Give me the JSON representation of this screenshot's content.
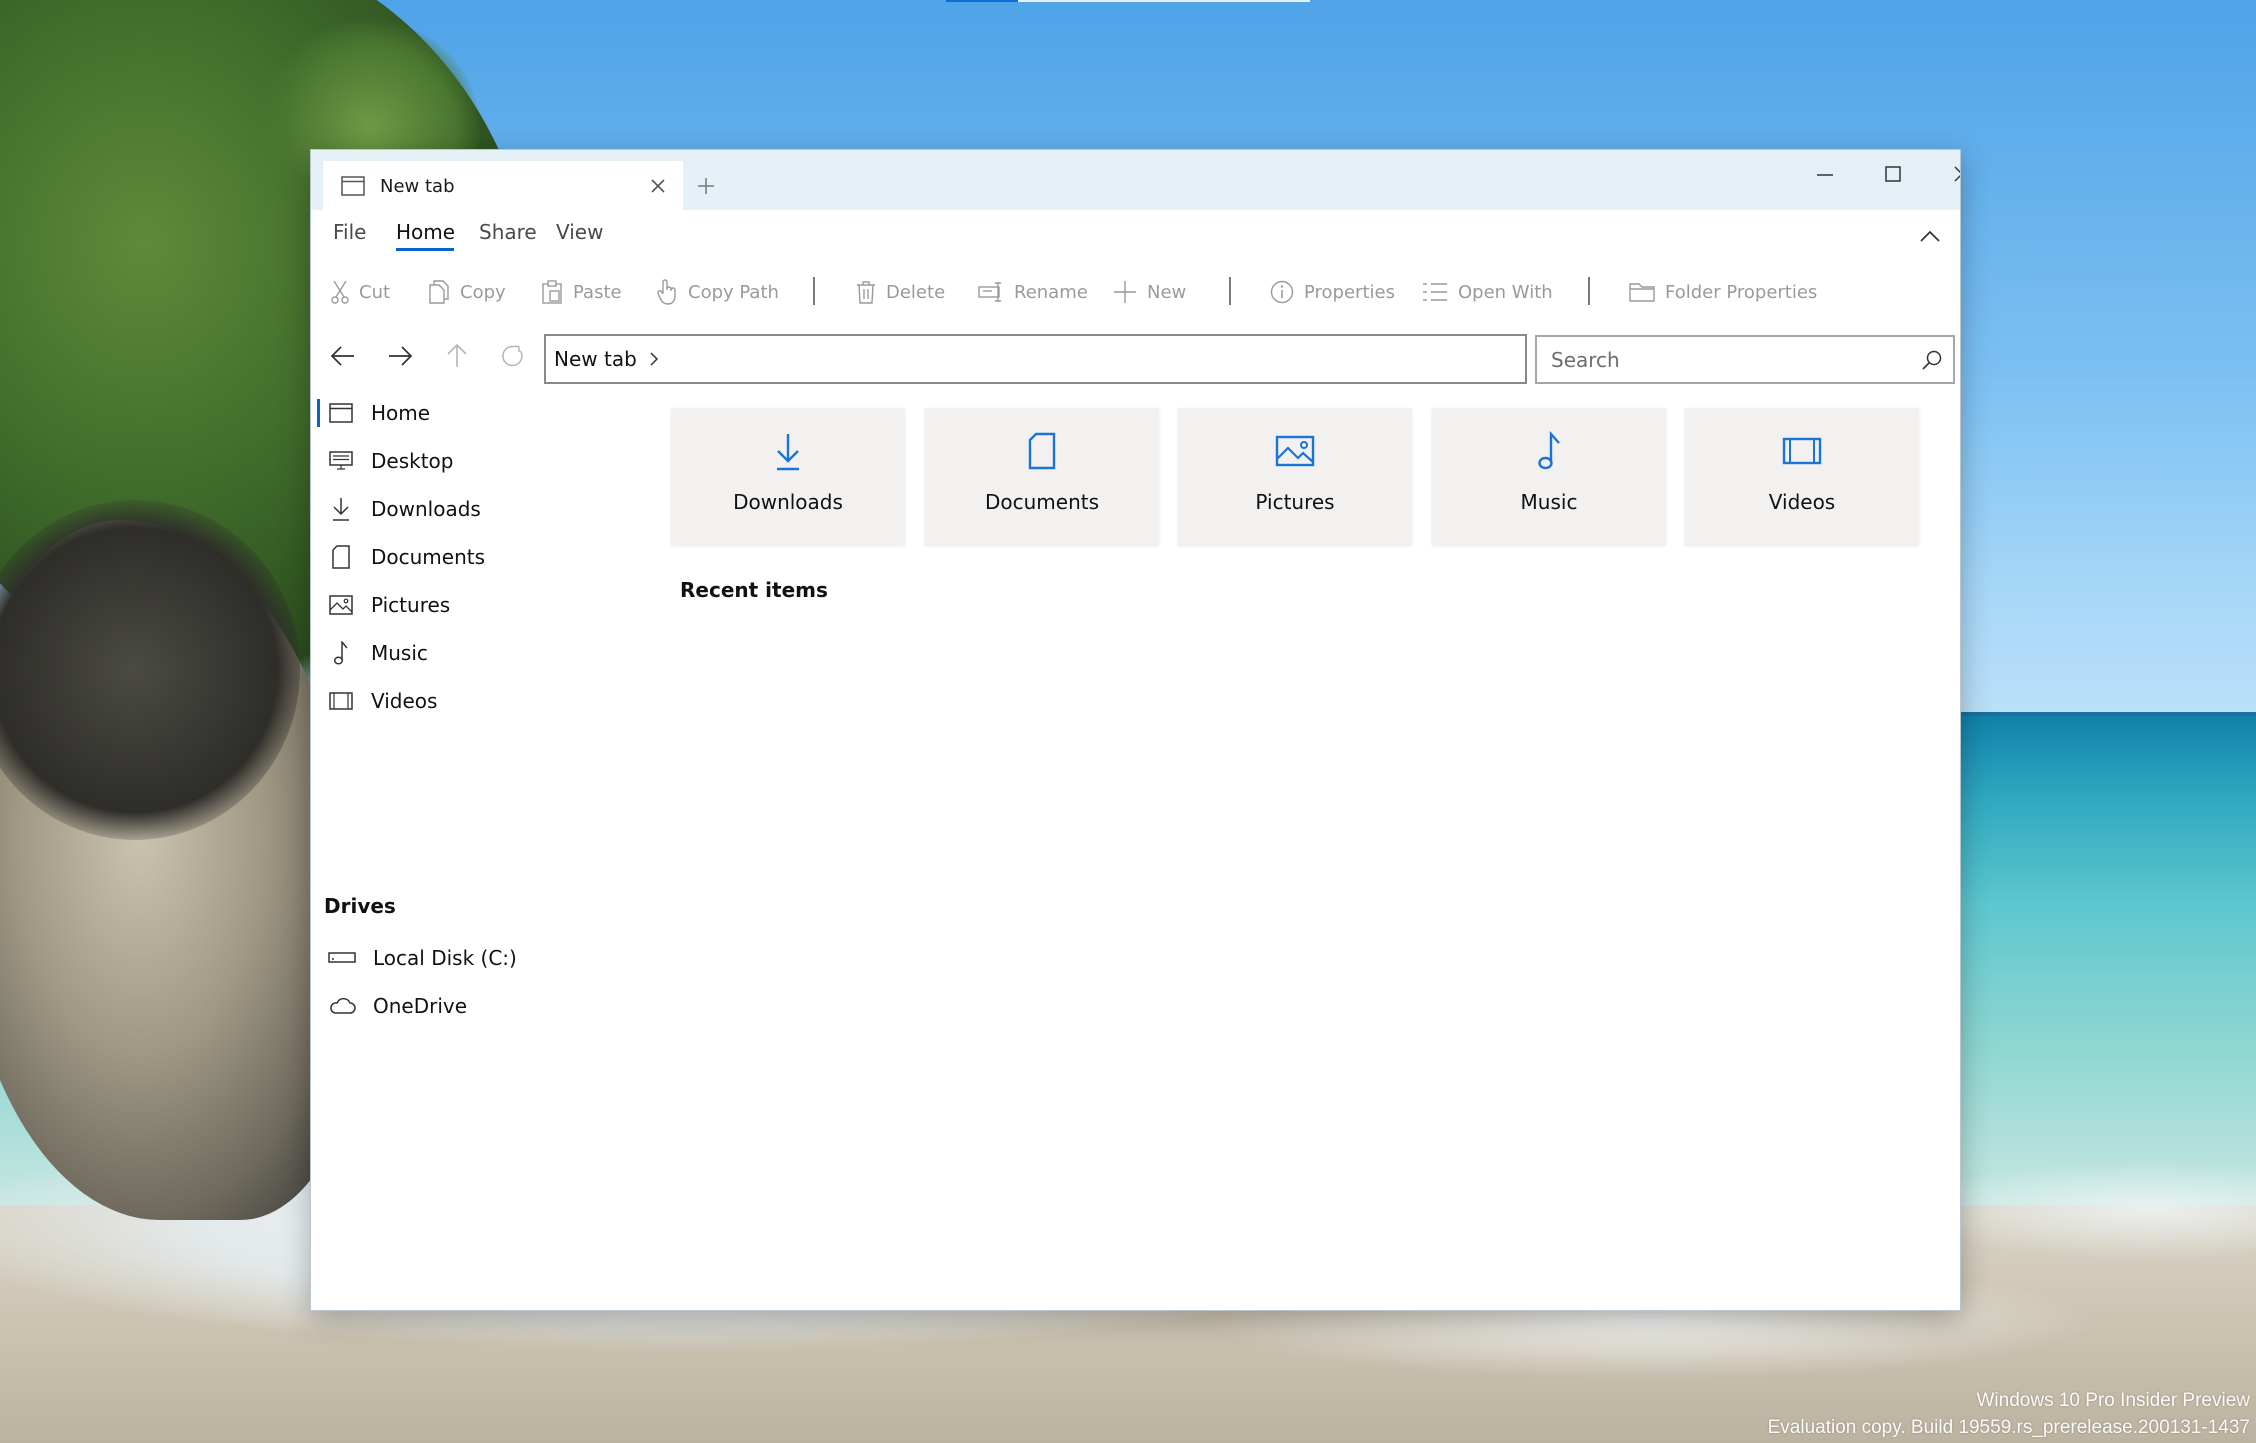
{
  "window": {
    "tab_title": "New tab",
    "tab_icon": "window-icon",
    "caption": {
      "minimize": "minimize-icon",
      "maximize": "maximize-icon",
      "close": "close-icon"
    }
  },
  "ribbon": {
    "tabs": [
      "File",
      "Home",
      "Share",
      "View"
    ],
    "active_tab": "Home"
  },
  "toolbar": {
    "cut": "Cut",
    "copy": "Copy",
    "paste": "Paste",
    "copy_path": "Copy Path",
    "delete": "Delete",
    "rename": "Rename",
    "new": "New",
    "properties": "Properties",
    "open_with": "Open With",
    "folder_properties": "Folder Properties"
  },
  "address": {
    "breadcrumb": "New tab",
    "search_placeholder": "Search"
  },
  "sidebar": {
    "items": [
      {
        "label": "Home",
        "icon": "home-window-icon",
        "selected": true
      },
      {
        "label": "Desktop",
        "icon": "desktop-icon"
      },
      {
        "label": "Downloads",
        "icon": "download-icon"
      },
      {
        "label": "Documents",
        "icon": "document-icon"
      },
      {
        "label": "Pictures",
        "icon": "picture-icon"
      },
      {
        "label": "Music",
        "icon": "music-note-icon"
      },
      {
        "label": "Videos",
        "icon": "video-icon"
      }
    ],
    "drives_heading": "Drives",
    "drives": [
      {
        "label": "Local Disk (C:)",
        "icon": "drive-icon"
      },
      {
        "label": "OneDrive",
        "icon": "cloud-icon"
      }
    ]
  },
  "main": {
    "cards": [
      {
        "label": "Downloads",
        "icon": "download-icon"
      },
      {
        "label": "Documents",
        "icon": "document-icon"
      },
      {
        "label": "Pictures",
        "icon": "picture-icon"
      },
      {
        "label": "Music",
        "icon": "music-note-icon"
      },
      {
        "label": "Videos",
        "icon": "video-icon"
      }
    ],
    "recent_heading": "Recent items"
  },
  "desktop": {
    "watermark_line1": "Windows 10 Pro Insider Preview",
    "watermark_line2": "Evaluation copy. Build 19559.rs_prerelease.200131-1437"
  },
  "colors": {
    "accent": "#0a63c6",
    "icon_blue": "#1a73d6",
    "disabled": "#9a9a9a"
  }
}
